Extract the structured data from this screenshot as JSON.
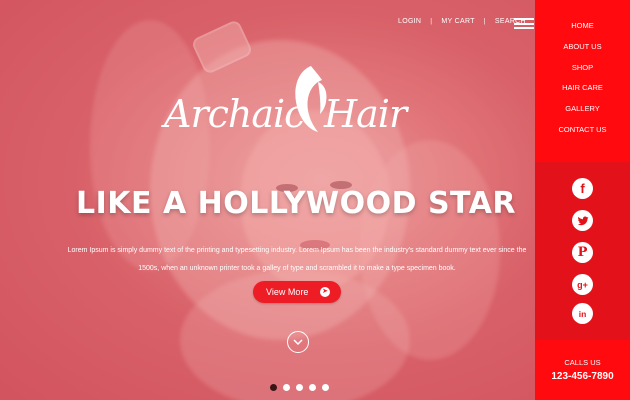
{
  "top_links": [
    "LOGIN",
    "MY CART",
    "SEARCH"
  ],
  "logo": {
    "word1": "Archaic",
    "word2": "Hair"
  },
  "hero": {
    "headline": "LIKE A HOLLYWOOD STAR",
    "description": "Lorem Ipsum is simply dummy text of the printing and typesetting industry. Lorem Ipsum has been the industry's standard dummy text ever since the 1500s, when an unknown printer took a galley of type and scrambled it to make a type specimen book.",
    "button": "View More"
  },
  "slider": {
    "count": 5,
    "active_index": 0
  },
  "nav": [
    "HOME",
    "ABOUT US",
    "SHOP",
    "HAIR CARE",
    "GALLERY",
    "CONTACT US"
  ],
  "social": [
    {
      "name": "facebook",
      "glyph": "f"
    },
    {
      "name": "twitter",
      "glyph": "t"
    },
    {
      "name": "pinterest",
      "glyph": "P"
    },
    {
      "name": "google-plus",
      "glyph": "g+"
    },
    {
      "name": "linkedin",
      "glyph": "in"
    }
  ],
  "call": {
    "label": "CALLS US",
    "number": "123-456-7890"
  },
  "colors": {
    "accent": "#ed1c24",
    "nav_bg": "#ff0a0f",
    "overlay": "#d94652"
  }
}
